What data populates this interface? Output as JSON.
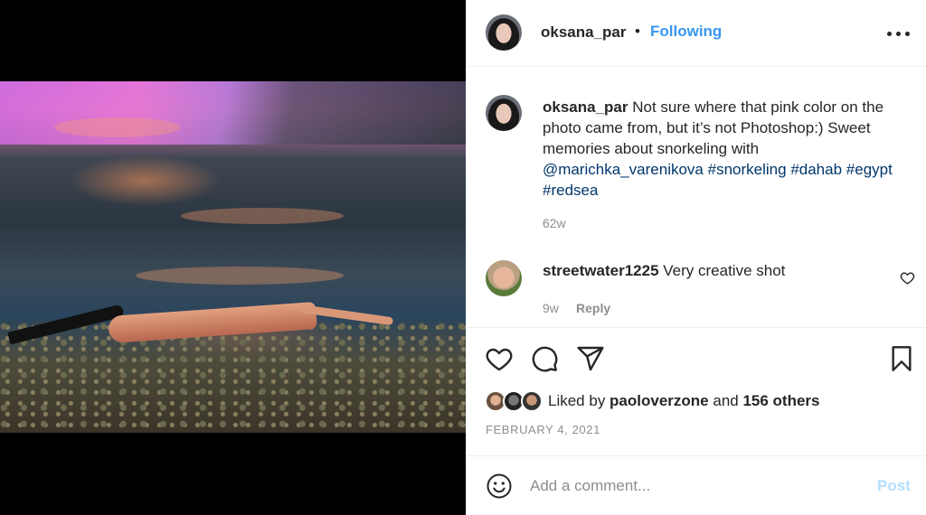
{
  "post": {
    "author": "oksana_par",
    "follow_status": "Following",
    "separator": "•"
  },
  "caption": {
    "author": "oksana_par",
    "body": " Not sure where that pink color on the photo came from, but it’s not Photoshop:) Sweet memories about snorkeling with ",
    "mention": "@marichka_varenikova",
    "tags": [
      "#snorkeling",
      "#dahab",
      "#egypt",
      "#redsea"
    ],
    "age": "62w"
  },
  "comment": {
    "author": "streetwater1225",
    "text": " Very creative shot",
    "age": "9w",
    "reply_label": "Reply"
  },
  "icons": {
    "more": "more-options-icon",
    "like": "heart-icon",
    "comment": "comment-icon",
    "share": "share-icon",
    "save": "bookmark-icon",
    "emoji": "emoji-icon"
  },
  "likes": {
    "prefix": "Liked by ",
    "first_liker": "paoloverzone",
    "middle": " and ",
    "others": "156 others"
  },
  "date": "FEBRUARY 4, 2021",
  "compose": {
    "placeholder": "Add a comment...",
    "post_label": "Post"
  },
  "colors": {
    "accent": "#3897f0",
    "link": "#00376b",
    "muted": "#8e8e8e",
    "post_disabled": "#b2dffc"
  }
}
